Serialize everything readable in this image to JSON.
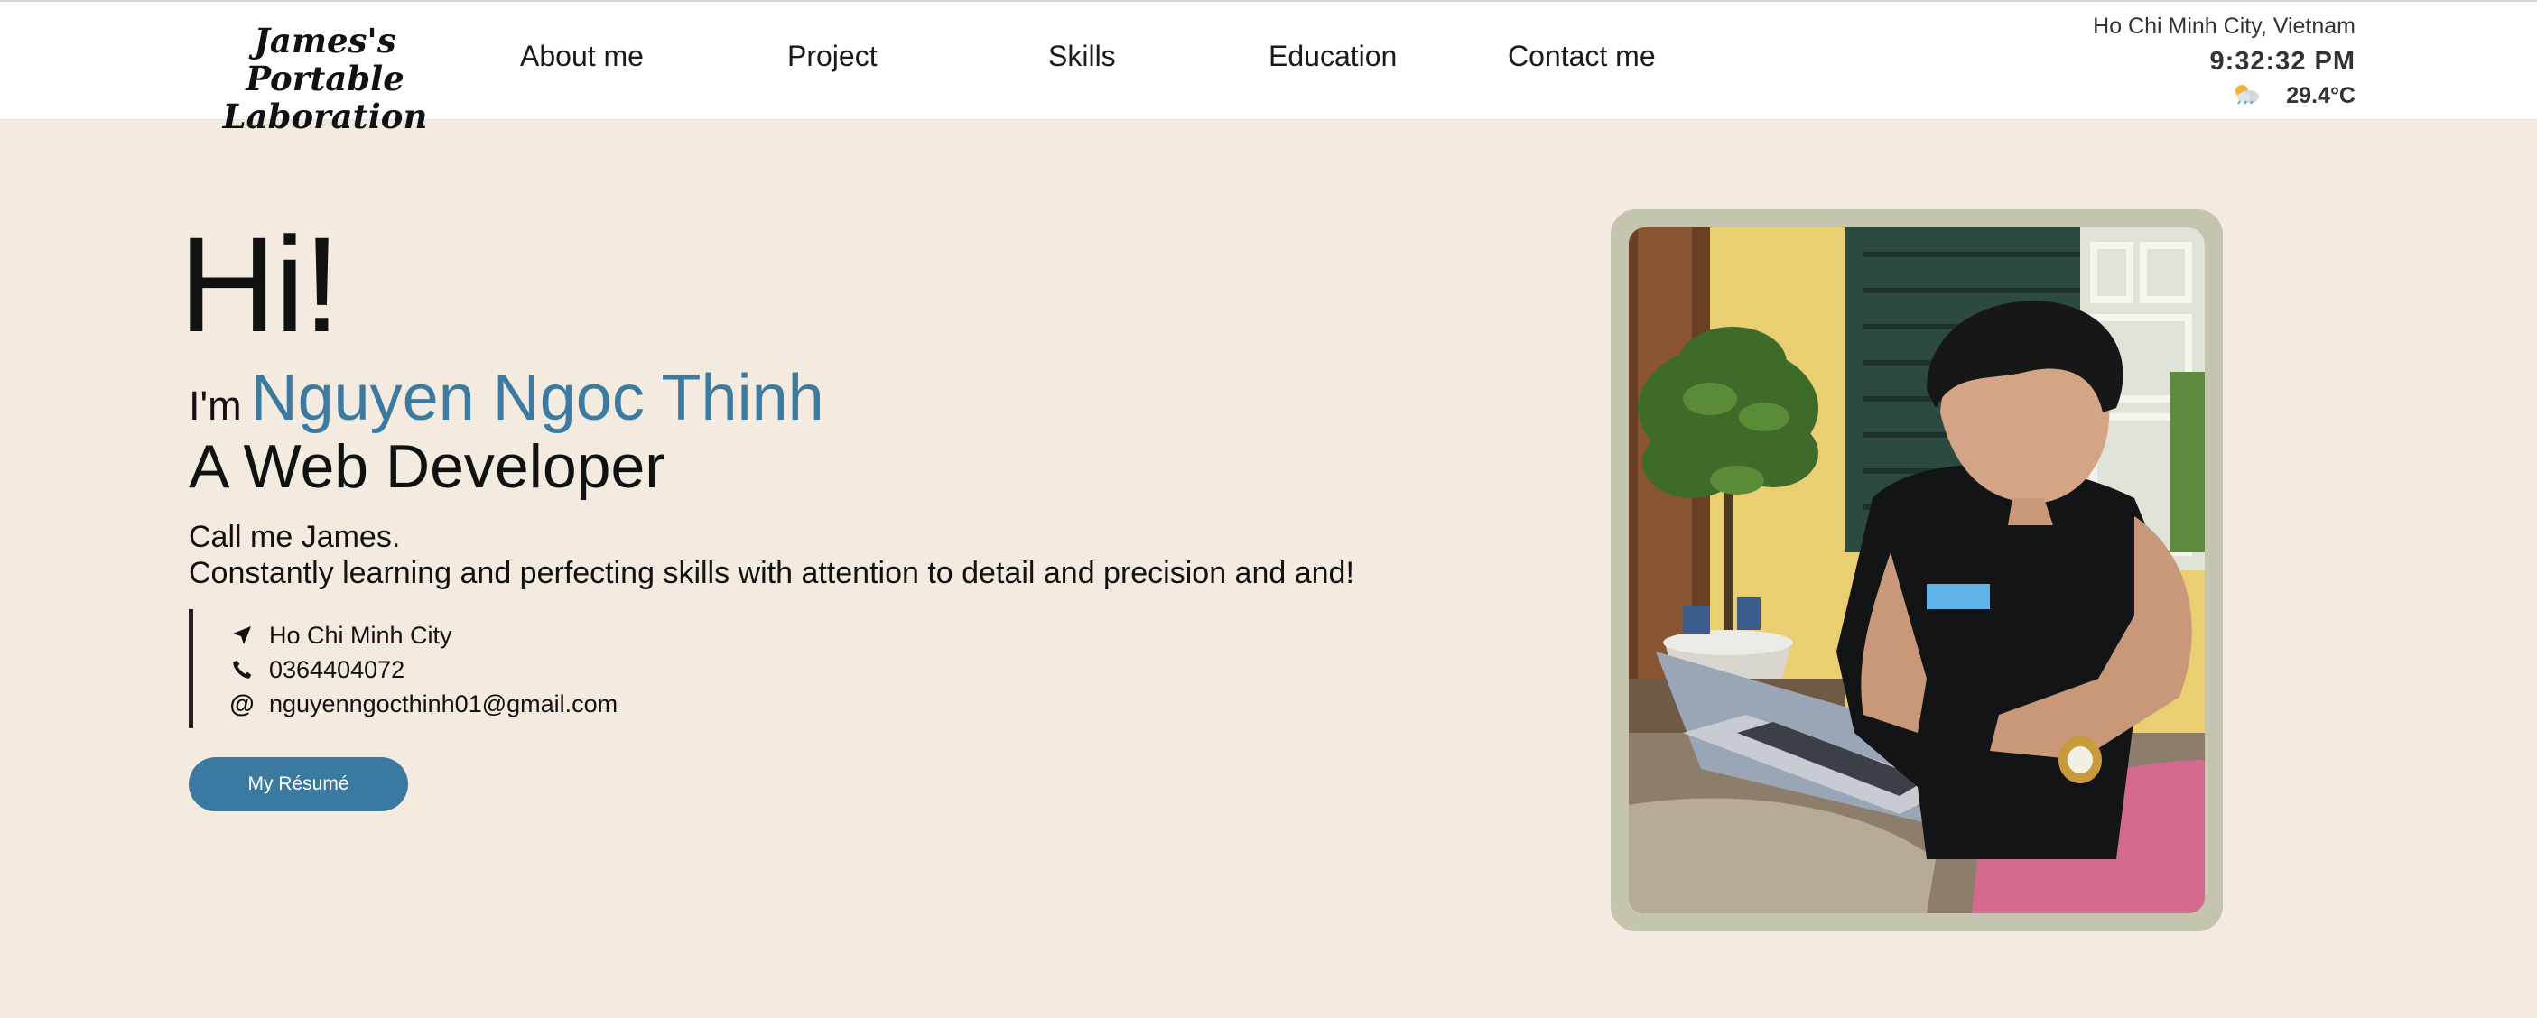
{
  "header": {
    "logo_line1": "James's Portable",
    "logo_line2": "Laboration",
    "nav": [
      "About me",
      "Project",
      "Skills",
      "Education",
      "Contact me"
    ],
    "weather": {
      "city": "Ho Chi Minh City, Vietnam",
      "time": "9:32:32 PM",
      "temperature": "29.4°C",
      "icon": "partly-cloudy-icon"
    }
  },
  "hero": {
    "greeting": "Hi!",
    "im_label": "I'm",
    "name": "Nguyen Ngoc Thinh",
    "role": "A Web Developer",
    "bio_line1": "Call me James.",
    "bio_line2": "Constantly learning and perfecting skills with attention to detail and precision and and!",
    "contact": {
      "location": "Ho Chi Minh City",
      "phone": "0364404072",
      "email": "nguyenngocthinh01@gmail.com"
    },
    "resume_button": "My Résumé"
  },
  "colors": {
    "background": "#f3ebe0",
    "accent": "#3c7aa0",
    "frame": "#c5c4ae"
  }
}
